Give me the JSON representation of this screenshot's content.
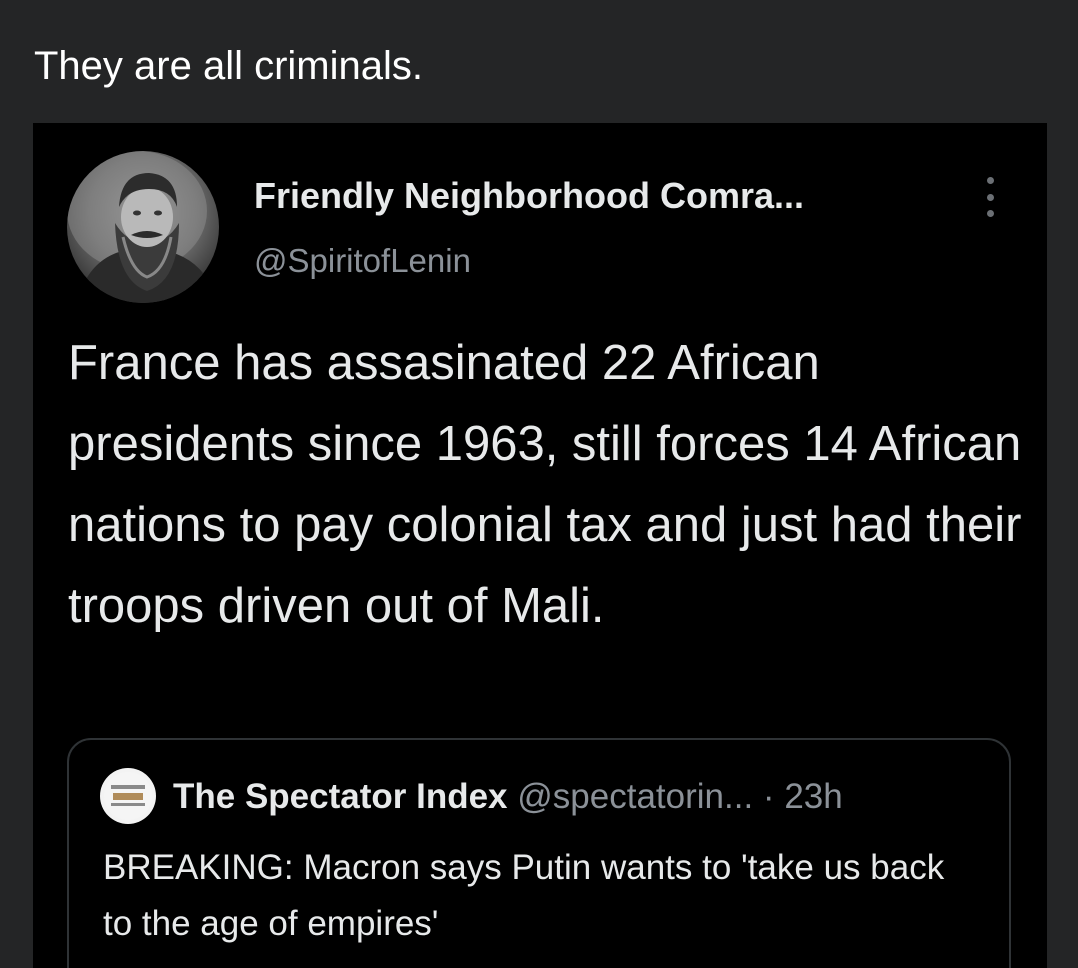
{
  "post": {
    "caption": "They are all criminals."
  },
  "tweet": {
    "author_name": "Friendly Neighborhood Comra...",
    "author_handle": "@SpiritofLenin",
    "more_icon": "more-vertical-icon",
    "text": "France has assasinated 22 African presidents since 1963, still forces 14 African nations to pay colonial tax and just had their troops driven out of Mali."
  },
  "quoted_tweet": {
    "author_name": "The Spectator Index",
    "author_handle": "@spectatorin...",
    "separator": "·",
    "time": "23h",
    "text": "BREAKING: Macron says Putin wants to 'take us back to the age of empires'"
  },
  "colors": {
    "page_background": "#242526",
    "tweet_background": "#000000",
    "primary_text": "#e7e9ea",
    "secondary_text": "#8b9198",
    "quote_border": "#2f3336"
  }
}
